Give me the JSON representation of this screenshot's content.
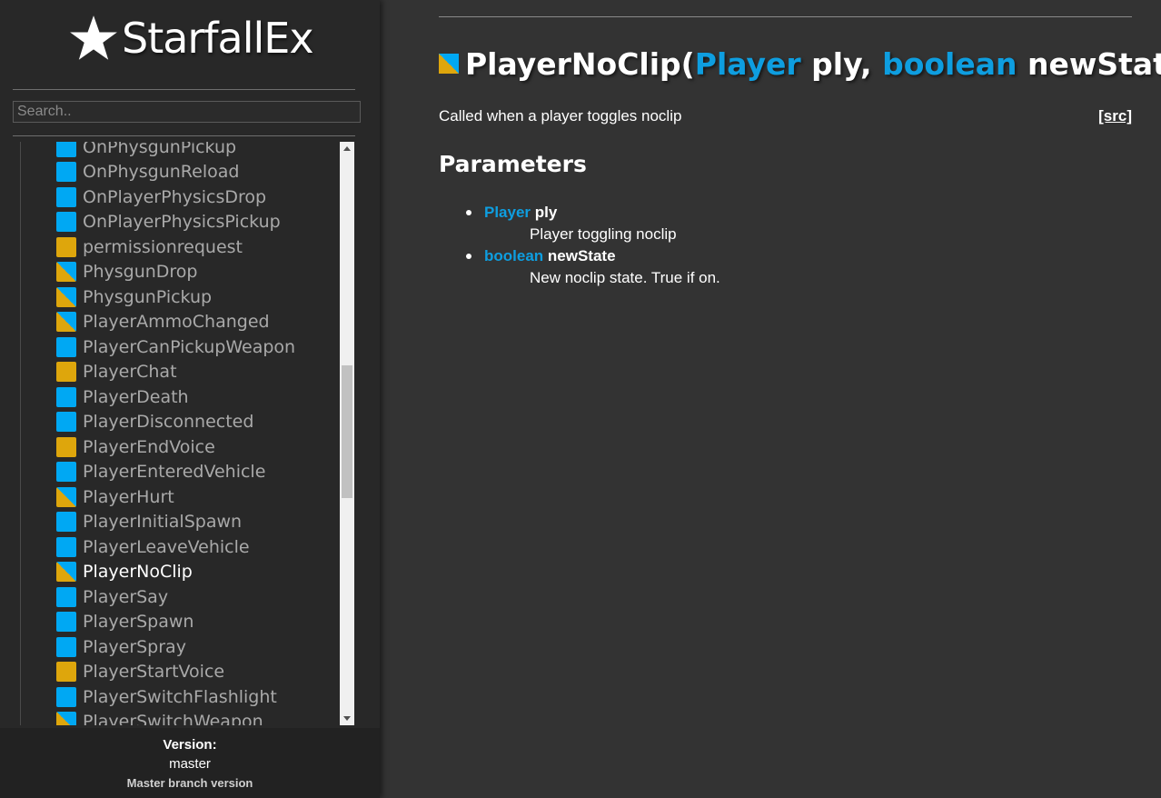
{
  "sidebar": {
    "logo_text": "StarfallEx",
    "search_placeholder": "Search..",
    "items": [
      {
        "label": "OnPhysgunPickup",
        "realm": "server"
      },
      {
        "label": "OnPhysgunReload",
        "realm": "server"
      },
      {
        "label": "OnPlayerPhysicsDrop",
        "realm": "server"
      },
      {
        "label": "OnPlayerPhysicsPickup",
        "realm": "server"
      },
      {
        "label": "permissionrequest",
        "realm": "client"
      },
      {
        "label": "PhysgunDrop",
        "realm": "shared"
      },
      {
        "label": "PhysgunPickup",
        "realm": "shared"
      },
      {
        "label": "PlayerAmmoChanged",
        "realm": "shared"
      },
      {
        "label": "PlayerCanPickupWeapon",
        "realm": "server"
      },
      {
        "label": "PlayerChat",
        "realm": "client"
      },
      {
        "label": "PlayerDeath",
        "realm": "server"
      },
      {
        "label": "PlayerDisconnected",
        "realm": "server"
      },
      {
        "label": "PlayerEndVoice",
        "realm": "client"
      },
      {
        "label": "PlayerEnteredVehicle",
        "realm": "server"
      },
      {
        "label": "PlayerHurt",
        "realm": "shared"
      },
      {
        "label": "PlayerInitialSpawn",
        "realm": "server"
      },
      {
        "label": "PlayerLeaveVehicle",
        "realm": "server"
      },
      {
        "label": "PlayerNoClip",
        "realm": "shared",
        "active": true
      },
      {
        "label": "PlayerSay",
        "realm": "server"
      },
      {
        "label": "PlayerSpawn",
        "realm": "server"
      },
      {
        "label": "PlayerSpray",
        "realm": "server"
      },
      {
        "label": "PlayerStartVoice",
        "realm": "client"
      },
      {
        "label": "PlayerSwitchFlashlight",
        "realm": "server"
      },
      {
        "label": "PlayerSwitchWeapon",
        "realm": "shared"
      }
    ],
    "version": {
      "label": "Version:",
      "value": "master",
      "description": "Master branch version"
    }
  },
  "main": {
    "title": {
      "name": "PlayerNoClip",
      "open_paren": "(",
      "arg1_type": "Player",
      "arg1_name": " ply, ",
      "arg2_type": "boolean",
      "arg2_name": " newState",
      "close_paren": ")"
    },
    "description": "Called when a player toggles noclip",
    "src_label": "[src]",
    "parameters_heading": "Parameters",
    "parameters": [
      {
        "type": "Player",
        "name": "ply",
        "description": "Player toggling noclip"
      },
      {
        "type": "boolean",
        "name": "newState",
        "description": "New noclip state. True if on."
      }
    ]
  },
  "colors": {
    "server": "#00a8f3",
    "client": "#dea60c",
    "link": "#0e9ee0",
    "background": "#333333",
    "sidebar": "#282828"
  }
}
